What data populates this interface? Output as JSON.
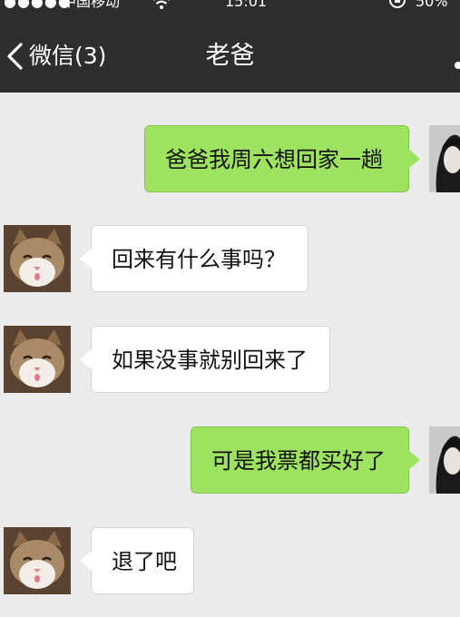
{
  "status_bar": {
    "signal": "●●●●●",
    "carrier": "中国移动",
    "time": "15:01",
    "battery": "50%"
  },
  "nav": {
    "back_label": "微信(3)",
    "title": "老爸"
  },
  "messages": [
    {
      "from": "me",
      "text": "爸爸我周六想回家一趟"
    },
    {
      "from": "dad",
      "text": "回来有什么事吗？"
    },
    {
      "from": "dad",
      "text": "如果没事就别回来了"
    },
    {
      "from": "me",
      "text": "可是我票都买好了"
    },
    {
      "from": "dad",
      "text": "退了吧"
    }
  ],
  "colors": {
    "nav_bg": "#2e2e2e",
    "chat_bg": "#ebebeb",
    "outgoing_bubble": "#9ee35f",
    "incoming_bubble": "#ffffff"
  }
}
